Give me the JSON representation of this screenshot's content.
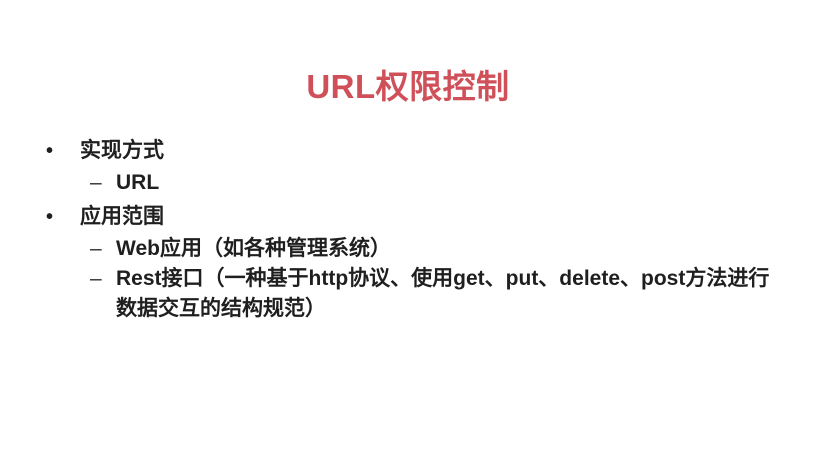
{
  "slide": {
    "title": "URL权限控制",
    "bullets": [
      {
        "marker": "•",
        "text": "实现方式",
        "sub": [
          {
            "marker": "–",
            "text": "URL"
          }
        ]
      },
      {
        "marker": "•",
        "text": "应用范围",
        "sub": [
          {
            "marker": "–",
            "text": "Web应用（如各种管理系统）"
          },
          {
            "marker": "–",
            "text": "Rest接口（一种基于http协议、使用get、put、delete、post方法进行数据交互的结构规范）"
          }
        ]
      }
    ],
    "colors": {
      "title": "#d0505a",
      "text": "#1f1f1f",
      "background": "#ffffff"
    }
  }
}
